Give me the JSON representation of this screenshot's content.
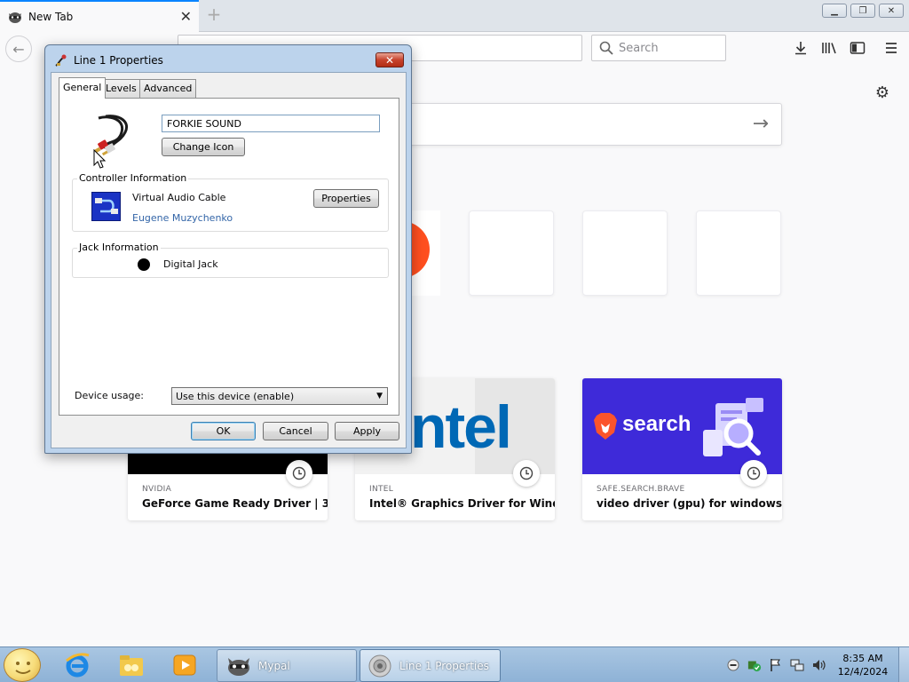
{
  "browser": {
    "tab_title": "New Tab",
    "new_tab_symbol": "+",
    "search_placeholder": "Search"
  },
  "cards": [
    {
      "source": "NVIDIA",
      "title": "GeForce Game Ready Driver | 3..."
    },
    {
      "source": "INTEL",
      "title": "Intel® Graphics Driver for Wind..."
    },
    {
      "source": "SAFE.SEARCH.BRAVE",
      "title": "video driver (gpu) for windows ..."
    }
  ],
  "card_thumbs": {
    "intel_text": "ntel",
    "brave_text": "search"
  },
  "dialog": {
    "title": "Line 1 Properties",
    "close_symbol": "✕",
    "tabs": [
      "General",
      "Levels",
      "Advanced"
    ],
    "device_name": "FORKIE SOUND",
    "change_icon_label": "Change Icon",
    "controller_heading": "Controller Information",
    "controller_name": "Virtual Audio Cable",
    "controller_vendor": "Eugene Muzychenko",
    "properties_label": "Properties",
    "jack_heading": "Jack Information",
    "jack_name": "Digital Jack",
    "usage_label": "Device usage:",
    "usage_value": "Use this device (enable)",
    "ok_label": "OK",
    "cancel_label": "Cancel",
    "apply_label": "Apply"
  },
  "taskbar": {
    "tasks": [
      "Mypal",
      "Line 1 Properties"
    ],
    "time": "8:35 AM",
    "date": "12/4/2024"
  },
  "colors": {
    "accent": "#0a84ff",
    "brave_bg": "#3e2ad9",
    "link": "#3466a8"
  }
}
